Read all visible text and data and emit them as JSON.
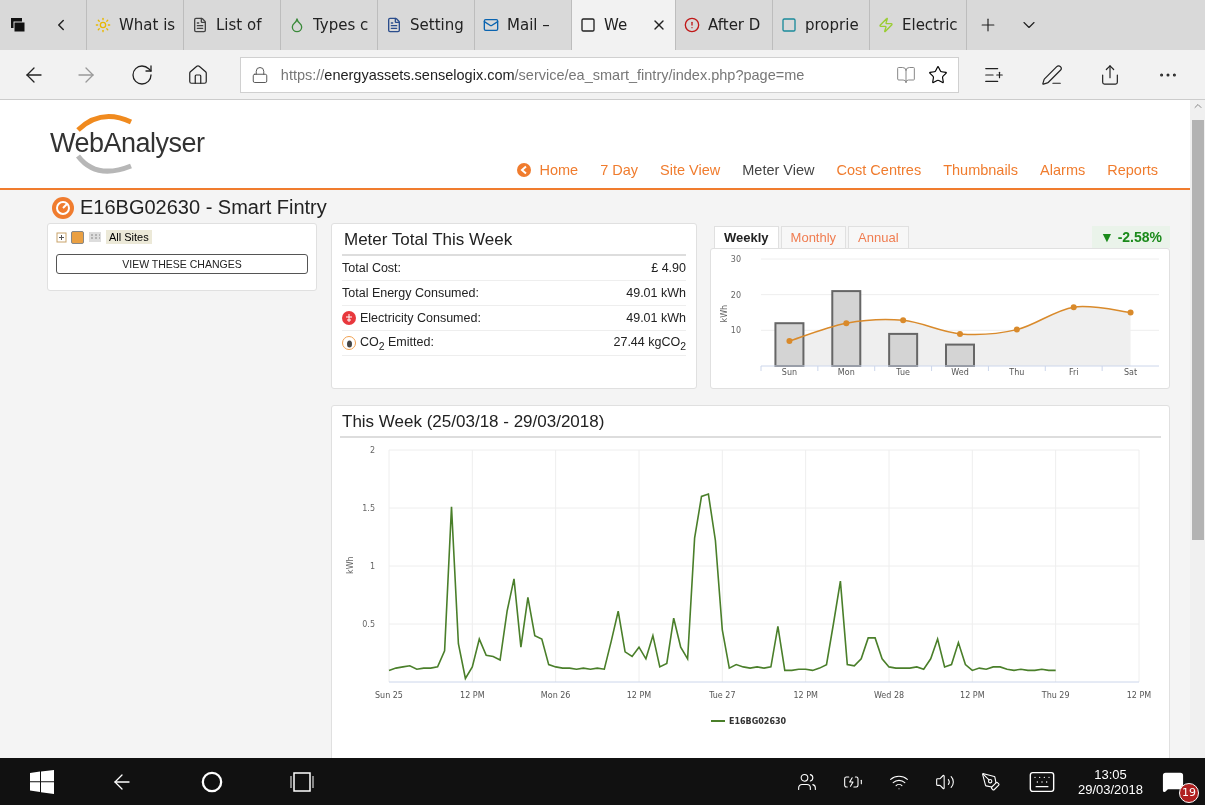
{
  "browser": {
    "tabs": [
      {
        "label": "What is",
        "selected": false
      },
      {
        "label": "List of",
        "selected": false
      },
      {
        "label": "Types c",
        "selected": false
      },
      {
        "label": "Setting",
        "selected": false
      },
      {
        "label": "Mail –",
        "selected": false
      },
      {
        "label": "We",
        "selected": true
      },
      {
        "label": "After D",
        "selected": false
      },
      {
        "label": "proprie",
        "selected": false
      },
      {
        "label": "Electric",
        "selected": false
      }
    ],
    "url": {
      "scheme": "https://",
      "domain": "energyassets.senselogix.com",
      "path": "/service/ea_smart_fintry/index.php?page=me"
    }
  },
  "site": {
    "logo": "WebAnalyser",
    "nav": [
      {
        "label": "Home",
        "selected": false
      },
      {
        "label": "7 Day",
        "selected": false
      },
      {
        "label": "Site View",
        "selected": false
      },
      {
        "label": "Meter View",
        "selected": true
      },
      {
        "label": "Cost Centres",
        "selected": false
      },
      {
        "label": "Thumbnails",
        "selected": false
      },
      {
        "label": "Alarms",
        "selected": false
      },
      {
        "label": "Reports",
        "selected": false
      }
    ],
    "title": "E16BG02630 - Smart Fintry"
  },
  "tree": {
    "label": "All Sites",
    "checked": true,
    "button": "VIEW THESE CHANGES"
  },
  "meter_total": {
    "title": "Meter Total This Week",
    "rows": [
      {
        "kind": "plain",
        "label": "Total Cost:",
        "value": "£ 4.90"
      },
      {
        "kind": "plain",
        "label": "Total Energy Consumed:",
        "value": "49.01 kWh"
      },
      {
        "kind": "electricity",
        "label": "Electricity Consumed:",
        "value": "49.01 kWh"
      },
      {
        "kind": "co2",
        "label": "CO$_{2}$ Emitted:",
        "value": "27.44 kgCO$_{2}$"
      }
    ]
  },
  "weekly": {
    "tabs": [
      {
        "label": "Weekly",
        "selected": true
      },
      {
        "label": "Monthly",
        "selected": false
      },
      {
        "label": "Annual",
        "selected": false
      }
    ],
    "change": "▼ -2.58%",
    "chart_data": {
      "type": "bar",
      "ylabel": "kWh",
      "categories": [
        "Sun",
        "Mon",
        "Tue",
        "Wed",
        "Thu",
        "Fri",
        "Sat"
      ],
      "ylim": [
        0,
        30
      ],
      "yticks": [
        10,
        20,
        30
      ],
      "series": [
        {
          "type": "bar",
          "color": "#d4d4d4",
          "values": [
            12,
            21,
            9,
            6,
            null,
            null,
            null
          ]
        },
        {
          "type": "area",
          "marker": true,
          "color": "#d98a2b",
          "values": [
            7,
            12,
            12.8,
            9,
            10.2,
            16.5,
            15
          ]
        }
      ]
    }
  },
  "this_week": {
    "title": "This Week (25/03/18 - 29/03/2018)",
    "chart_data": {
      "type": "line",
      "grid": true,
      "ylabel": "kWh",
      "ylim": [
        0,
        2
      ],
      "yticks": [
        0.5,
        1,
        1.5,
        2
      ],
      "categories": [
        "Sun 25",
        null,
        null,
        null,
        null,
        null,
        null,
        null,
        null,
        null,
        null,
        null,
        "12 PM",
        null,
        null,
        null,
        null,
        null,
        null,
        null,
        null,
        null,
        null,
        null,
        "Mon 26",
        null,
        null,
        null,
        null,
        null,
        null,
        null,
        null,
        null,
        null,
        null,
        "12 PM",
        null,
        null,
        null,
        null,
        null,
        null,
        null,
        null,
        null,
        null,
        null,
        "Tue 27",
        null,
        null,
        null,
        null,
        null,
        null,
        null,
        null,
        null,
        null,
        null,
        "12 PM",
        null,
        null,
        null,
        null,
        null,
        null,
        null,
        null,
        null,
        null,
        null,
        "Wed 28",
        null,
        null,
        null,
        null,
        null,
        null,
        null,
        null,
        null,
        null,
        null,
        "12 PM",
        null,
        null,
        null,
        null,
        null,
        null,
        null,
        null,
        null,
        null,
        null,
        "Thu 29",
        null,
        null,
        null,
        null,
        null,
        null,
        null,
        null,
        null,
        null,
        null,
        "12 PM"
      ],
      "series": [
        {
          "name": "E16BG02630",
          "color": "#4a7f2a",
          "values": [
            0.1,
            0.12,
            0.13,
            0.14,
            0.11,
            0.12,
            0.12,
            0.13,
            0.27,
            1.51,
            0.33,
            0.03,
            0.13,
            0.37,
            0.23,
            0.22,
            0.19,
            0.61,
            0.89,
            0.3,
            0.73,
            0.4,
            0.37,
            0.15,
            0.13,
            0.12,
            0.12,
            0.11,
            0.12,
            0.11,
            0.12,
            0.11,
            0.35,
            0.61,
            0.26,
            0.22,
            0.3,
            0.2,
            0.4,
            0.13,
            0.16,
            0.55,
            0.3,
            0.2,
            1.24,
            1.6,
            1.62,
            1.22,
            0.45,
            0.12,
            0.15,
            0.13,
            0.12,
            0.13,
            0.12,
            0.13,
            0.48,
            0.1,
            0.1,
            0.11,
            0.11,
            0.1,
            0.12,
            0.15,
            0.5,
            0.87,
            0.15,
            0.14,
            0.2,
            0.38,
            0.38,
            0.2,
            0.13,
            0.12,
            0.12,
            0.12,
            0.13,
            0.11,
            0.2,
            0.37,
            0.13,
            0.15,
            0.34,
            0.15,
            0.1,
            0.12,
            0.11,
            0.13,
            0.13,
            0.11,
            0.1,
            0.11,
            0.1,
            0.1,
            0.11,
            0.1,
            0.1,
            null,
            null,
            null,
            null,
            null,
            null,
            null,
            null,
            null,
            null,
            null,
            null
          ]
        }
      ]
    }
  },
  "taskbar": {
    "time": "13:05",
    "date": "29/03/2018",
    "notifications": "19"
  }
}
